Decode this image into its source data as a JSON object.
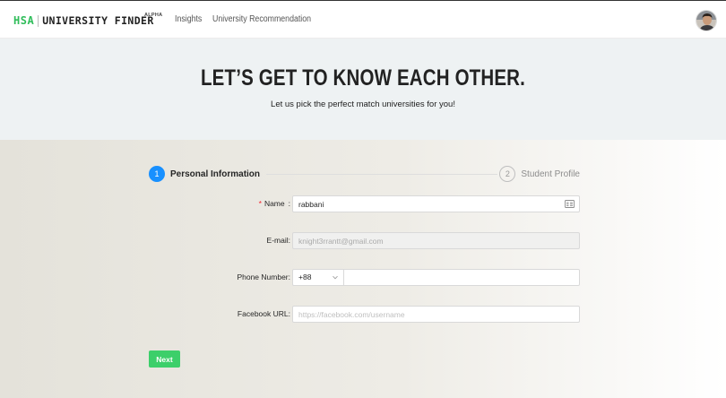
{
  "brand": {
    "short": "HSA",
    "name": "UNIVERSITY FINDER",
    "badge": "ALPHA"
  },
  "nav": {
    "links": [
      {
        "label": "Insights"
      },
      {
        "label": "University Recommendation"
      }
    ]
  },
  "hero": {
    "title": "LET’S GET TO KNOW EACH OTHER.",
    "subtitle": "Let us pick the perfect match universities for you!"
  },
  "steps": [
    {
      "number": "1",
      "title": "Personal Information",
      "status": "active"
    },
    {
      "number": "2",
      "title": "Student Profile",
      "status": "wait"
    }
  ],
  "form": {
    "name": {
      "label": "Name",
      "separator": ":",
      "required_mark": "*",
      "value": "rabbani"
    },
    "email": {
      "label": "E-mail",
      "separator": ":",
      "value": "knight3rrantt@gmail.com"
    },
    "phone": {
      "label": "Phone Number",
      "separator": ":",
      "prefix": "+88",
      "value": ""
    },
    "facebook": {
      "label": "Facebook URL",
      "separator": ":",
      "placeholder": "https://facebook.com/username",
      "value": ""
    }
  },
  "actions": {
    "next_label": "Next"
  },
  "colors": {
    "primary": "#1890ff",
    "brand_green": "#2fbd5a",
    "button_green": "#3ccf6a",
    "required": "#f5222d"
  }
}
